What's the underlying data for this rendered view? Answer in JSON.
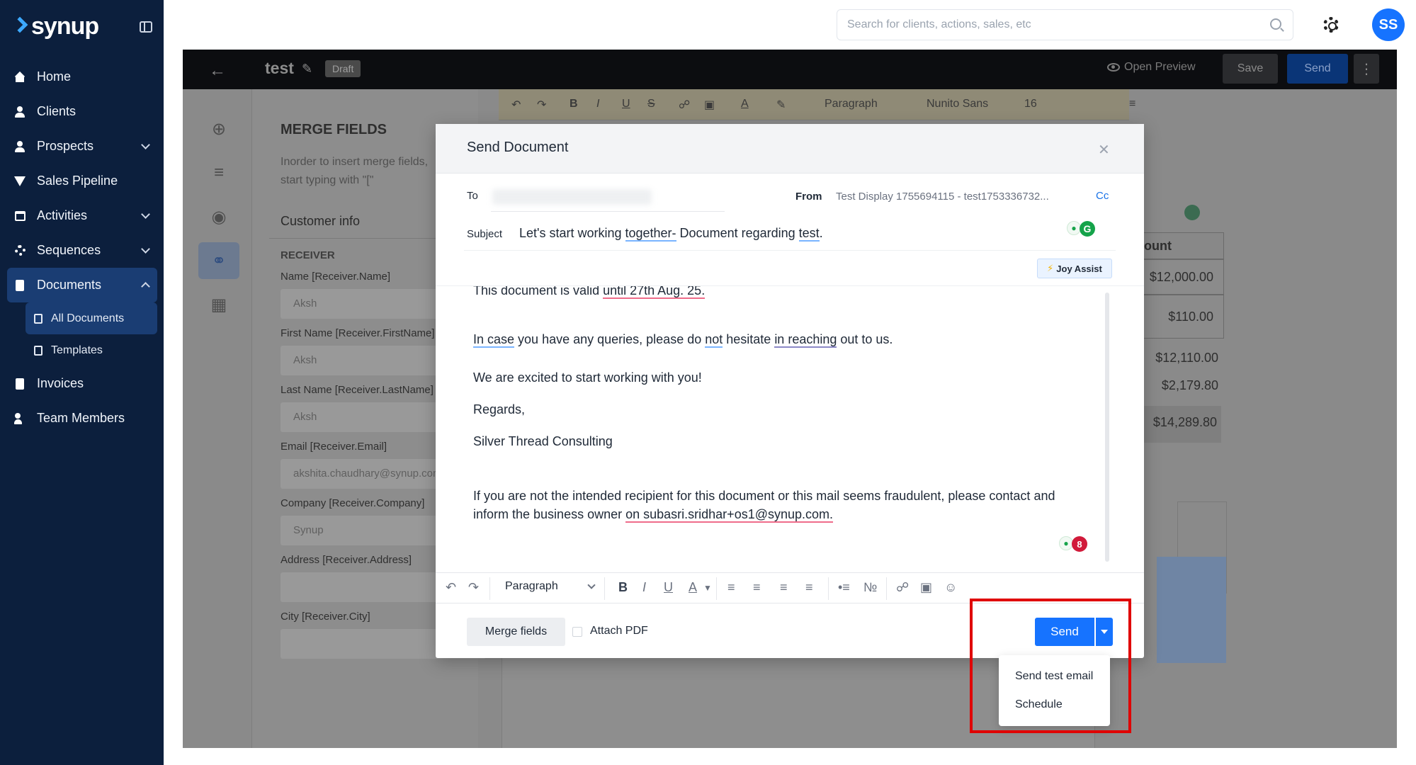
{
  "sidebar": {
    "logo_text": "synup",
    "items": [
      {
        "label": "Home",
        "icon": "home-icon"
      },
      {
        "label": "Clients",
        "icon": "user-icon"
      },
      {
        "label": "Prospects",
        "icon": "prospects-icon"
      },
      {
        "label": "Sales Pipeline",
        "icon": "funnel-icon"
      },
      {
        "label": "Activities",
        "icon": "calendar-icon"
      },
      {
        "label": "Sequences",
        "icon": "gear-icon"
      },
      {
        "label": "Documents",
        "icon": "document-icon"
      },
      {
        "label": "Invoices",
        "icon": "invoice-icon"
      },
      {
        "label": "Team Members",
        "icon": "team-icon"
      }
    ],
    "documents_sub": [
      {
        "label": "All Documents"
      },
      {
        "label": "Templates"
      }
    ]
  },
  "topbar": {
    "search_placeholder": "Search for clients, actions, sales, etc",
    "avatar_initials": "SS"
  },
  "doc_header": {
    "title": "test",
    "status_badge": "Draft",
    "open_preview": "Open Preview",
    "save_label": "Save",
    "send_label": "Send"
  },
  "merge_panel": {
    "title": "MERGE FIELDS",
    "description": "Inorder to insert merge fields, start typing with \"[\"",
    "tab": "Customer info",
    "section": "RECEIVER",
    "fields": [
      {
        "label": "Name [Receiver.Name]",
        "value": "Aksh"
      },
      {
        "label": "First Name [Receiver.FirstName]",
        "value": "Aksh"
      },
      {
        "label": "Last Name [Receiver.LastName]",
        "value": "Aksh"
      },
      {
        "label": "Email [Receiver.Email]",
        "value": "akshita.chaudhary@synup.com"
      },
      {
        "label": "Company [Receiver.Company]",
        "value": "Synup"
      },
      {
        "label": "Address [Receiver.Address]",
        "value": ""
      },
      {
        "label": "City [Receiver.City]",
        "value": ""
      }
    ]
  },
  "format_bar": {
    "block_type": "Paragraph",
    "font_family": "Nunito Sans",
    "font_size": "16"
  },
  "price_table": {
    "header": "ount",
    "rows": [
      "$12,000.00",
      "$110.00"
    ],
    "totals": [
      "$12,110.00",
      "$2,179.80",
      "$14,289.80"
    ]
  },
  "modal": {
    "title": "Send Document",
    "to_label": "To",
    "from_label": "From",
    "from_value": "Test Display 1755694115 - test1753336732...",
    "cc_label": "Cc",
    "subject_label": "Subject",
    "subject_parts": [
      "Let's start working ",
      "together-",
      " Document regarding ",
      "test",
      "."
    ],
    "joy_assist": "Joy Assist",
    "body": {
      "line1": [
        "This document is valid ",
        "until 27th Aug. 25."
      ],
      "line2": [
        "In case",
        " you have any queries, please do ",
        "not",
        " hesitate ",
        "in reaching",
        " out to us."
      ],
      "line3": "We are excited to start working with you!",
      "line4": "Regards,",
      "line5": "Silver Thread Consulting",
      "line6": "If you are not the intended recipient for this document or this mail seems fraudulent, please contact and",
      "line7": [
        "inform the business owner ",
        "on subasri.sridhar+os1@synup.com."
      ]
    },
    "grammarly_badge": "8",
    "toolbar": {
      "block_type": "Paragraph"
    },
    "merge_fields_btn": "Merge fields",
    "attach_pdf": "Attach PDF",
    "send_btn": "Send",
    "send_menu": [
      "Send test email",
      "Schedule"
    ]
  },
  "colors": {
    "sidebar_bg": "#0c1f3d",
    "primary": "#1673ff",
    "highlight": "#e00000"
  }
}
